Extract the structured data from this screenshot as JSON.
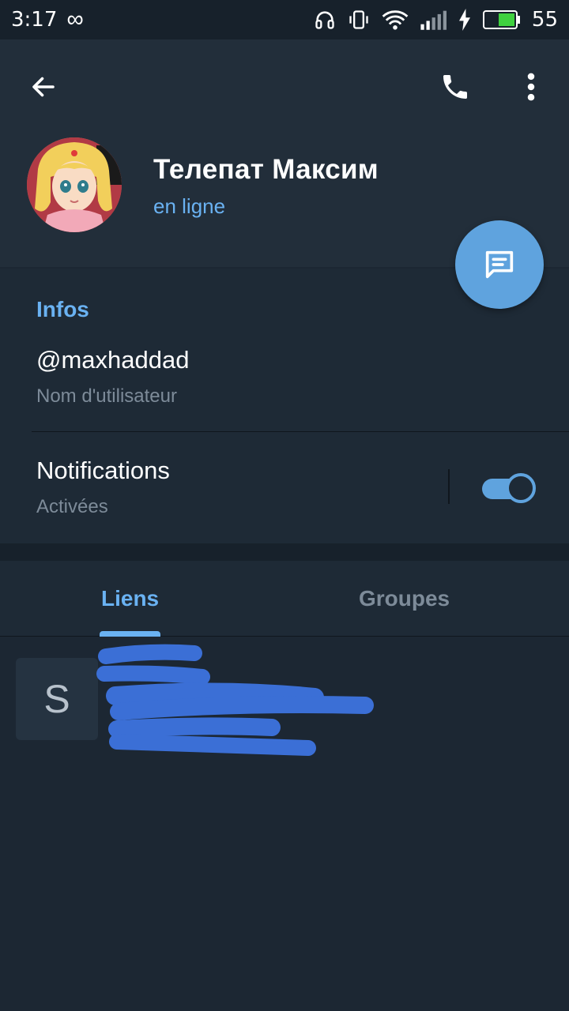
{
  "status_bar": {
    "time": "3:17",
    "infinity_symbol": "∞",
    "battery_level": "55",
    "icons": [
      "headphones-icon",
      "vibrate-icon",
      "wifi-icon",
      "signal-icon",
      "charging-icon",
      "battery-icon"
    ]
  },
  "header": {
    "back_icon": "arrow-left-icon",
    "call_icon": "phone-icon",
    "more_icon": "more-vertical-icon",
    "name": "Телепат Максим",
    "status": "en ligne"
  },
  "fab": {
    "icon": "message-icon"
  },
  "info": {
    "title": "Infos",
    "username": "@maxhaddad",
    "username_label": "Nom d'utilisateur",
    "notifications_title": "Notifications",
    "notifications_status": "Activées",
    "notifications_enabled": true
  },
  "tabs": [
    {
      "label": "Liens",
      "active": true
    },
    {
      "label": "Groupes",
      "active": false
    }
  ],
  "links": [
    {
      "thumb_letter": "S"
    }
  ],
  "colors": {
    "background": "#1c2733",
    "header": "#222e3a",
    "accent": "#6ab2f2",
    "fab": "#5fa3de",
    "redaction": "#3b6fd6"
  }
}
